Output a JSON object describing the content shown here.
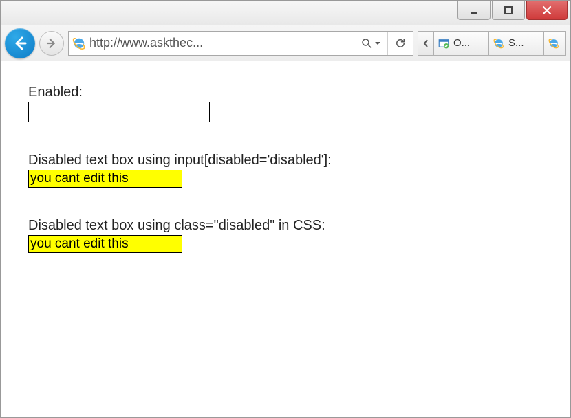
{
  "address_url": "http://www.askthec...",
  "tabs": {
    "first_label": "O...",
    "second_label": "S..."
  },
  "content": {
    "enabled_label": "Enabled:",
    "enabled_value": "",
    "disabled1_label": "Disabled text box using input[disabled='disabled']:",
    "disabled1_value": "you cant edit this",
    "disabled2_label": "Disabled text box using class=\"disabled\" in CSS:",
    "disabled2_value": "you cant edit this"
  }
}
